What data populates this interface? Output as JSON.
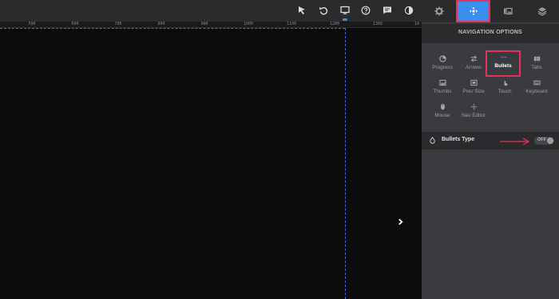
{
  "toolbar": {
    "tools": [
      {
        "icon": "cursor-icon"
      },
      {
        "icon": "undo-icon"
      },
      {
        "icon": "desktop-icon"
      },
      {
        "icon": "help-icon"
      },
      {
        "icon": "comment-icon"
      },
      {
        "icon": "contrast-icon"
      }
    ]
  },
  "ruler": {
    "ticks": [
      "500",
      "600",
      "700",
      "800",
      "900",
      "1000",
      "1100",
      "1200",
      "1300",
      "14"
    ]
  },
  "panel": {
    "tabs": [
      {
        "icon": "gear-icon"
      },
      {
        "icon": "navigation-icon"
      },
      {
        "icon": "slides-icon"
      },
      {
        "icon": "layers-icon"
      }
    ],
    "section_title": "NAVIGATION OPTIONS",
    "options": [
      {
        "label": "Progress",
        "icon": "progress-icon"
      },
      {
        "label": "Arrows",
        "icon": "arrows-icon"
      },
      {
        "label": "Bullets",
        "icon": "bullets-icon"
      },
      {
        "label": "Tabs",
        "icon": "tabs-icon"
      },
      {
        "label": "Thumbs",
        "icon": "thumbs-icon"
      },
      {
        "label": "Prev Size",
        "icon": "prev-size-icon"
      },
      {
        "label": "Touch",
        "icon": "touch-icon"
      },
      {
        "label": "Keyboard",
        "icon": "keyboard-icon"
      },
      {
        "label": "Mouse",
        "icon": "mouse-icon"
      },
      {
        "label": "Nav Editor",
        "icon": "nav-editor-icon"
      }
    ],
    "bullets_type": {
      "label": "Bullets Type",
      "toggle_text": "OFF"
    }
  },
  "colors": {
    "accent": "#3a8ef0",
    "highlight": "#e8315a",
    "panel_bg": "#3a3b3e",
    "canvas_bg": "#0c0c0c"
  }
}
